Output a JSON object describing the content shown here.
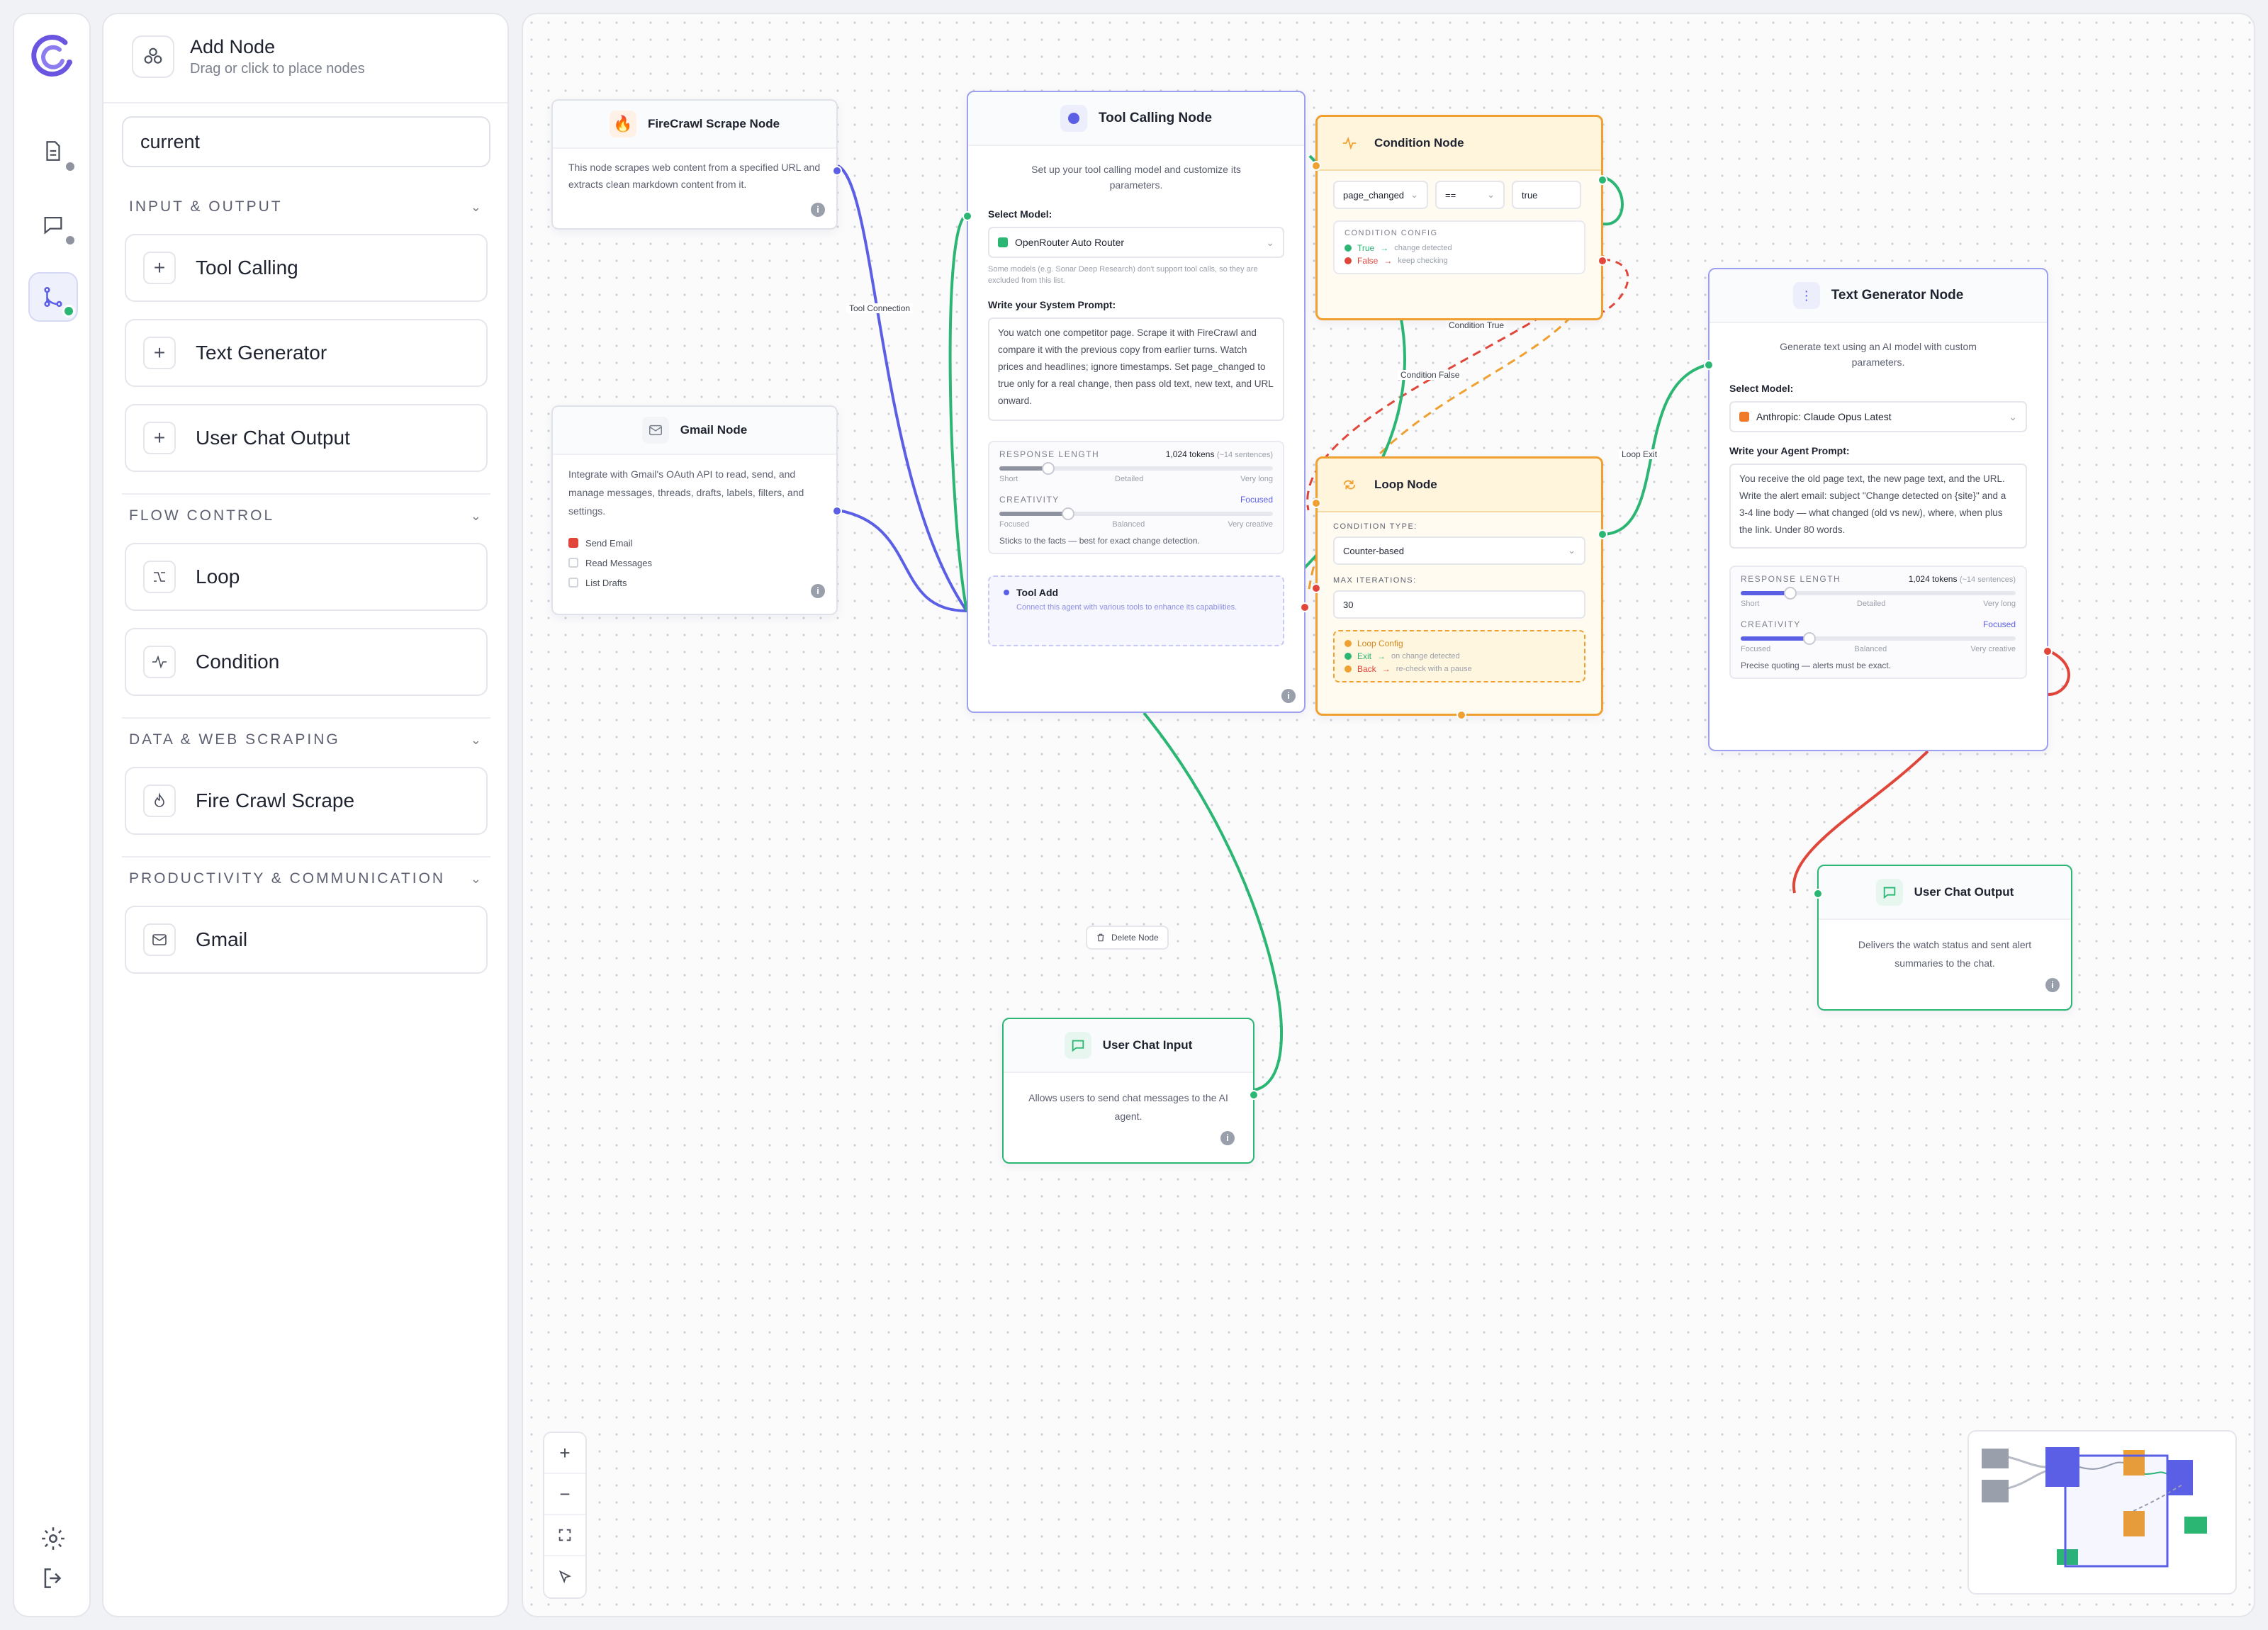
{
  "panel": {
    "title": "Add Node",
    "subtitle": "Drag or click to place nodes",
    "search_value": "current",
    "sections": [
      {
        "title": "INPUT & OUTPUT",
        "items": [
          "Tool Calling",
          "Text Generator",
          "User Chat Output"
        ]
      },
      {
        "title": "FLOW CONTROL",
        "items": [
          "Loop",
          "Condition"
        ]
      },
      {
        "title": "DATA & WEB SCRAPING",
        "items": [
          "Fire Crawl Scrape"
        ]
      },
      {
        "title": "PRODUCTIVITY & COMMUNICATION",
        "items": [
          "Gmail"
        ]
      }
    ]
  },
  "nodes": {
    "firecrawl": {
      "title": "FireCrawl Scrape Node",
      "desc": "This node scrapes web content from a specified URL and extracts clean markdown content from it."
    },
    "gmail": {
      "title": "Gmail Node",
      "desc": "Integrate with Gmail's OAuth API to read, send, and manage messages, threads, drafts, labels, filters, and settings.",
      "options": [
        "Send Email",
        "Read Messages",
        "List Drafts"
      ]
    },
    "tool_calling": {
      "title": "Tool Calling Node",
      "desc": "Set up your tool calling model and customize its parameters.",
      "select_model_label": "Select Model:",
      "model": "OpenRouter Auto Router",
      "model_note": "Some models (e.g. Sonar Deep Research) don't support tool calls, so they are excluded from this list.",
      "prompt_label": "Write your System Prompt:",
      "prompt": "You watch one competitor page. Scrape it with FireCrawl and compare it with the previous copy from earlier turns. Watch prices and headlines; ignore timestamps. Set page_changed to true only for a real change, then pass old text, new text, and URL onward.",
      "response_length_label": "RESPONSE LENGTH",
      "response_length_value": "1,024 tokens",
      "response_length_hint": "(~14 sentences)",
      "length_ticks": [
        "Short",
        "Detailed",
        "Very long"
      ],
      "creativity_label": "CREATIVITY",
      "creativity_value": "Focused",
      "creativity_ticks": [
        "Focused",
        "Balanced",
        "Very creative"
      ],
      "creativity_note": "Sticks to the facts — best for exact change detection.",
      "tool_add_title": "Tool Add",
      "tool_add_desc": "Connect this agent with various tools to enhance its capabilities."
    },
    "condition": {
      "title": "Condition Node",
      "field": "page_changed",
      "operator": "==",
      "value": "true",
      "config_label": "CONDITION CONFIG",
      "true_label": "True",
      "true_text": "change detected",
      "false_label": "False",
      "false_text": "keep checking"
    },
    "loop": {
      "title": "Loop Node",
      "type_label": "CONDITION TYPE:",
      "type_value": "Counter-based",
      "max_label": "MAX ITERATIONS:",
      "max_value": "30",
      "config_label": "Loop Config",
      "exit_label": "Exit",
      "exit_text": "on change detected",
      "back_label": "Back",
      "back_text": "re-check with a pause"
    },
    "text_gen": {
      "title": "Text Generator Node",
      "desc": "Generate text using an AI model with custom parameters.",
      "select_model_label": "Select Model:",
      "model": "Anthropic: Claude Opus Latest",
      "prompt_label": "Write your Agent Prompt:",
      "prompt": "You receive the old page text, the new page text, and the URL. Write the alert email: subject \"Change detected on {site}\" and a 3-4 line body — what changed (old vs new), where, when plus the link. Under 80 words.",
      "response_length_label": "RESPONSE LENGTH",
      "response_length_value": "1,024 tokens",
      "response_length_hint": "(~14 sentences)",
      "length_ticks": [
        "Short",
        "Detailed",
        "Very long"
      ],
      "creativity_label": "CREATIVITY",
      "creativity_value": "Focused",
      "creativity_ticks": [
        "Focused",
        "Balanced",
        "Very creative"
      ],
      "creativity_note": "Precise quoting — alerts must be exact."
    },
    "user_output": {
      "title": "User Chat Output",
      "desc": "Delivers the watch status and sent alert summaries to the chat."
    },
    "user_input": {
      "title": "User Chat Input",
      "desc": "Allows users to send chat messages to the AI agent."
    }
  },
  "edges": {
    "tool_connection": "Tool Connection",
    "condition_true": "Condition True",
    "condition_false": "Condition False",
    "loop_exit": "Loop Exit"
  },
  "delete_node_label": "Delete Node",
  "zoom_controls": [
    "+",
    "−"
  ],
  "colors": {
    "accent": "#5b5fe6",
    "orange": "#f0a030",
    "green": "#2bb673",
    "red": "#e0463a",
    "condition_fill": "#fff8e6"
  },
  "response_length_fraction": 0.18,
  "creativity_fraction": 0.25,
  "icons": [
    "logo-icon",
    "document-icon",
    "chat-icon",
    "flow-icon",
    "settings-icon",
    "logout-icon",
    "plus-icon",
    "loop-icon",
    "condition-icon",
    "fire-icon",
    "mail-icon"
  ]
}
